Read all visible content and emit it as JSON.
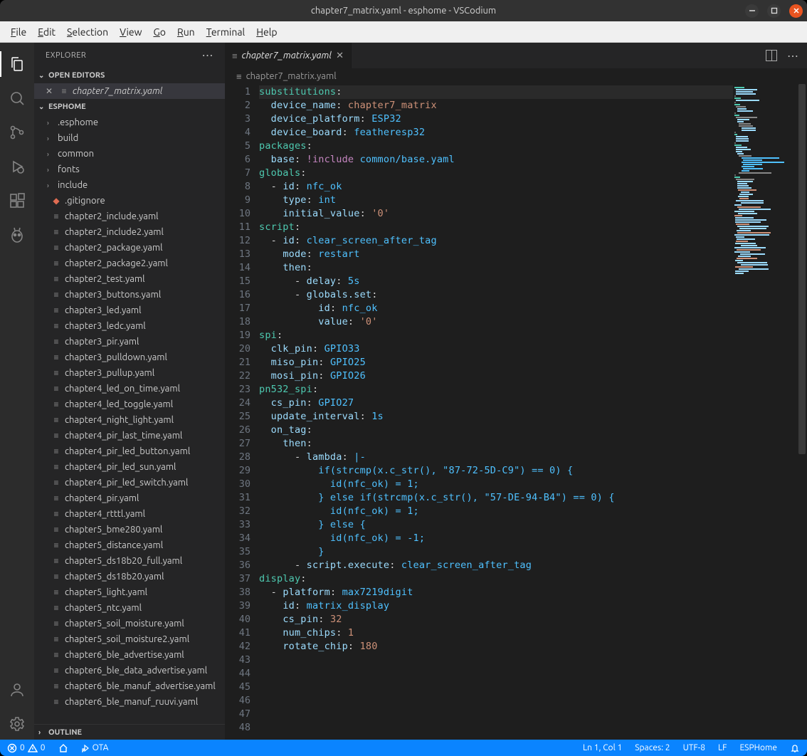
{
  "window": {
    "title": "chapter7_matrix.yaml - esphome - VSCodium"
  },
  "menu": [
    "File",
    "Edit",
    "Selection",
    "View",
    "Go",
    "Run",
    "Terminal",
    "Help"
  ],
  "sidebar": {
    "title": "EXPLORER",
    "open_editors_label": "OPEN EDITORS",
    "open_editor_file": "chapter7_matrix.yaml",
    "workspace": "ESPHOME",
    "folders": [
      ".esphome",
      "build",
      "common",
      "fonts",
      "include"
    ],
    "gitignore": ".gitignore",
    "files": [
      "chapter2_include.yaml",
      "chapter2_include2.yaml",
      "chapter2_package.yaml",
      "chapter2_package2.yaml",
      "chapter2_test.yaml",
      "chapter3_buttons.yaml",
      "chapter3_led.yaml",
      "chapter3_ledc.yaml",
      "chapter3_pir.yaml",
      "chapter3_pulldown.yaml",
      "chapter3_pullup.yaml",
      "chapter4_led_on_time.yaml",
      "chapter4_led_toggle.yaml",
      "chapter4_night_light.yaml",
      "chapter4_pir_last_time.yaml",
      "chapter4_pir_led_button.yaml",
      "chapter4_pir_led_sun.yaml",
      "chapter4_pir_led_switch.yaml",
      "chapter4_pir.yaml",
      "chapter4_rtttl.yaml",
      "chapter5_bme280.yaml",
      "chapter5_distance.yaml",
      "chapter5_ds18b20_full.yaml",
      "chapter5_ds18b20.yaml",
      "chapter5_light.yaml",
      "chapter5_ntc.yaml",
      "chapter5_soil_moisture.yaml",
      "chapter5_soil_moisture2.yaml",
      "chapter6_ble_advertise.yaml",
      "chapter6_ble_data_advertise.yaml",
      "chapter6_ble_manuf_advertise.yaml",
      "chapter6_ble_manuf_ruuvi.yaml"
    ],
    "outline_label": "OUTLINE"
  },
  "tab": {
    "label": "chapter7_matrix.yaml"
  },
  "breadcrumb": "chapter7_matrix.yaml",
  "code": [
    {
      "n": 1,
      "hl": true,
      "seg": [
        [
          "substitutions",
          "tk-key"
        ],
        [
          ":",
          "tk-punct"
        ]
      ]
    },
    {
      "n": 2,
      "seg": [
        [
          "  ",
          "tk-plain"
        ],
        [
          "device_name",
          "tk-prop"
        ],
        [
          ": ",
          "tk-punct"
        ],
        [
          "chapter7_matrix",
          "tk-str"
        ]
      ]
    },
    {
      "n": 3,
      "seg": [
        [
          "  ",
          "tk-plain"
        ],
        [
          "device_platform",
          "tk-prop"
        ],
        [
          ": ",
          "tk-punct"
        ],
        [
          "ESP32",
          "tk-pl"
        ]
      ]
    },
    {
      "n": 4,
      "seg": [
        [
          "  ",
          "tk-plain"
        ],
        [
          "device_board",
          "tk-prop"
        ],
        [
          ": ",
          "tk-punct"
        ],
        [
          "featheresp32",
          "tk-pl"
        ]
      ]
    },
    {
      "n": 5,
      "seg": [
        [
          "",
          "tk-plain"
        ]
      ]
    },
    {
      "n": 6,
      "seg": [
        [
          "packages",
          "tk-key"
        ],
        [
          ":",
          "tk-punct"
        ]
      ]
    },
    {
      "n": 7,
      "seg": [
        [
          "  ",
          "tk-plain"
        ],
        [
          "base",
          "tk-prop"
        ],
        [
          ": ",
          "tk-punct"
        ],
        [
          "!include",
          "tk-tag"
        ],
        [
          " ",
          "tk-plain"
        ],
        [
          "common/base.yaml",
          "tk-pl"
        ]
      ]
    },
    {
      "n": 8,
      "seg": [
        [
          "",
          "tk-plain"
        ]
      ]
    },
    {
      "n": 9,
      "seg": [
        [
          "globals",
          "tk-key"
        ],
        [
          ":",
          "tk-punct"
        ]
      ]
    },
    {
      "n": 10,
      "seg": [
        [
          "  - ",
          "tk-dash"
        ],
        [
          "id",
          "tk-prop"
        ],
        [
          ": ",
          "tk-punct"
        ],
        [
          "nfc_ok",
          "tk-pl"
        ]
      ]
    },
    {
      "n": 11,
      "seg": [
        [
          "    ",
          "tk-plain"
        ],
        [
          "type",
          "tk-prop"
        ],
        [
          ": ",
          "tk-punct"
        ],
        [
          "int",
          "tk-pl"
        ]
      ]
    },
    {
      "n": 12,
      "seg": [
        [
          "    ",
          "tk-plain"
        ],
        [
          "initial_value",
          "tk-prop"
        ],
        [
          ": ",
          "tk-punct"
        ],
        [
          "'0'",
          "tk-str"
        ]
      ]
    },
    {
      "n": 13,
      "seg": [
        [
          "",
          "tk-plain"
        ]
      ]
    },
    {
      "n": 14,
      "seg": [
        [
          "script",
          "tk-key"
        ],
        [
          ":",
          "tk-punct"
        ]
      ]
    },
    {
      "n": 15,
      "seg": [
        [
          "  - ",
          "tk-dash"
        ],
        [
          "id",
          "tk-prop"
        ],
        [
          ": ",
          "tk-punct"
        ],
        [
          "clear_screen_after_tag",
          "tk-pl"
        ]
      ]
    },
    {
      "n": 16,
      "seg": [
        [
          "    ",
          "tk-plain"
        ],
        [
          "mode",
          "tk-prop"
        ],
        [
          ": ",
          "tk-punct"
        ],
        [
          "restart",
          "tk-pl"
        ]
      ]
    },
    {
      "n": 17,
      "seg": [
        [
          "    ",
          "tk-plain"
        ],
        [
          "then",
          "tk-prop"
        ],
        [
          ":",
          "tk-punct"
        ]
      ]
    },
    {
      "n": 18,
      "seg": [
        [
          "      - ",
          "tk-dash"
        ],
        [
          "delay",
          "tk-prop"
        ],
        [
          ": ",
          "tk-punct"
        ],
        [
          "5s",
          "tk-pl"
        ]
      ]
    },
    {
      "n": 19,
      "seg": [
        [
          "      - ",
          "tk-dash"
        ],
        [
          "globals.set",
          "tk-prop"
        ],
        [
          ":",
          "tk-punct"
        ]
      ]
    },
    {
      "n": 20,
      "seg": [
        [
          "          ",
          "tk-plain"
        ],
        [
          "id",
          "tk-prop"
        ],
        [
          ": ",
          "tk-punct"
        ],
        [
          "nfc_ok",
          "tk-pl"
        ]
      ]
    },
    {
      "n": 21,
      "seg": [
        [
          "          ",
          "tk-plain"
        ],
        [
          "value",
          "tk-prop"
        ],
        [
          ": ",
          "tk-punct"
        ],
        [
          "'0'",
          "tk-str"
        ]
      ]
    },
    {
      "n": 22,
      "seg": [
        [
          "",
          "tk-plain"
        ]
      ]
    },
    {
      "n": 23,
      "seg": [
        [
          "spi",
          "tk-key"
        ],
        [
          ":",
          "tk-punct"
        ]
      ]
    },
    {
      "n": 24,
      "seg": [
        [
          "  ",
          "tk-plain"
        ],
        [
          "clk_pin",
          "tk-prop"
        ],
        [
          ": ",
          "tk-punct"
        ],
        [
          "GPIO33",
          "tk-pl"
        ]
      ]
    },
    {
      "n": 25,
      "seg": [
        [
          "  ",
          "tk-plain"
        ],
        [
          "miso_pin",
          "tk-prop"
        ],
        [
          ": ",
          "tk-punct"
        ],
        [
          "GPIO25",
          "tk-pl"
        ]
      ]
    },
    {
      "n": 26,
      "seg": [
        [
          "  ",
          "tk-plain"
        ],
        [
          "mosi_pin",
          "tk-prop"
        ],
        [
          ": ",
          "tk-punct"
        ],
        [
          "GPIO26",
          "tk-pl"
        ]
      ]
    },
    {
      "n": 27,
      "seg": [
        [
          "",
          "tk-plain"
        ]
      ]
    },
    {
      "n": 28,
      "seg": [
        [
          "pn532_spi",
          "tk-key"
        ],
        [
          ":",
          "tk-punct"
        ]
      ]
    },
    {
      "n": 29,
      "seg": [
        [
          "  ",
          "tk-plain"
        ],
        [
          "cs_pin",
          "tk-prop"
        ],
        [
          ": ",
          "tk-punct"
        ],
        [
          "GPIO27",
          "tk-pl"
        ]
      ]
    },
    {
      "n": 30,
      "seg": [
        [
          "  ",
          "tk-plain"
        ],
        [
          "update_interval",
          "tk-prop"
        ],
        [
          ": ",
          "tk-punct"
        ],
        [
          "1s",
          "tk-pl"
        ]
      ]
    },
    {
      "n": 31,
      "seg": [
        [
          "  ",
          "tk-plain"
        ],
        [
          "on_tag",
          "tk-prop"
        ],
        [
          ":",
          "tk-punct"
        ]
      ]
    },
    {
      "n": 32,
      "seg": [
        [
          "    ",
          "tk-plain"
        ],
        [
          "then",
          "tk-prop"
        ],
        [
          ":",
          "tk-punct"
        ]
      ]
    },
    {
      "n": 33,
      "seg": [
        [
          "      - ",
          "tk-dash"
        ],
        [
          "lambda",
          "tk-prop"
        ],
        [
          ": ",
          "tk-punct"
        ],
        [
          "|-",
          "tk-pl"
        ]
      ]
    },
    {
      "n": 34,
      "seg": [
        [
          "          if(strcmp(x.c_str(), \"87-72-5D-C9\") == 0) {",
          "tk-pl"
        ]
      ]
    },
    {
      "n": 35,
      "seg": [
        [
          "            id(nfc_ok) = 1;",
          "tk-pl"
        ]
      ]
    },
    {
      "n": 36,
      "seg": [
        [
          "          } else if(strcmp(x.c_str(), \"57-DE-94-B4\") == 0) {",
          "tk-pl"
        ]
      ]
    },
    {
      "n": 37,
      "seg": [
        [
          "            id(nfc_ok) = 1;",
          "tk-pl"
        ]
      ]
    },
    {
      "n": 38,
      "seg": [
        [
          "          } else {",
          "tk-pl"
        ]
      ]
    },
    {
      "n": 39,
      "seg": [
        [
          "            id(nfc_ok) = -1;",
          "tk-pl"
        ]
      ]
    },
    {
      "n": 40,
      "seg": [
        [
          "          }",
          "tk-pl"
        ]
      ]
    },
    {
      "n": 41,
      "seg": [
        [
          "      - ",
          "tk-dash"
        ],
        [
          "script.execute",
          "tk-prop"
        ],
        [
          ": ",
          "tk-punct"
        ],
        [
          "clear_screen_after_tag",
          "tk-pl"
        ]
      ]
    },
    {
      "n": 42,
      "seg": [
        [
          "",
          "tk-plain"
        ]
      ]
    },
    {
      "n": 43,
      "seg": [
        [
          "display",
          "tk-key"
        ],
        [
          ":",
          "tk-punct"
        ]
      ]
    },
    {
      "n": 44,
      "seg": [
        [
          "  - ",
          "tk-dash"
        ],
        [
          "platform",
          "tk-prop"
        ],
        [
          ": ",
          "tk-punct"
        ],
        [
          "max7219digit",
          "tk-pl"
        ]
      ]
    },
    {
      "n": 45,
      "seg": [
        [
          "    ",
          "tk-plain"
        ],
        [
          "id",
          "tk-prop"
        ],
        [
          ": ",
          "tk-punct"
        ],
        [
          "matrix_display",
          "tk-pl"
        ]
      ]
    },
    {
      "n": 46,
      "seg": [
        [
          "    ",
          "tk-plain"
        ],
        [
          "cs_pin",
          "tk-prop"
        ],
        [
          ": ",
          "tk-punct"
        ],
        [
          "32",
          "tk-num"
        ]
      ]
    },
    {
      "n": 47,
      "seg": [
        [
          "    ",
          "tk-plain"
        ],
        [
          "num_chips",
          "tk-prop"
        ],
        [
          ": ",
          "tk-punct"
        ],
        [
          "1",
          "tk-num"
        ]
      ]
    },
    {
      "n": 48,
      "seg": [
        [
          "    ",
          "tk-plain"
        ],
        [
          "rotate_chip",
          "tk-prop"
        ],
        [
          ": ",
          "tk-punct"
        ],
        [
          "180",
          "tk-num"
        ]
      ]
    }
  ],
  "status": {
    "errors": "0",
    "warnings": "0",
    "ota": "OTA",
    "pos": "Ln 1, Col 1",
    "spaces": "Spaces: 2",
    "enc": "UTF-8",
    "eol": "LF",
    "lang": "ESPHome"
  }
}
